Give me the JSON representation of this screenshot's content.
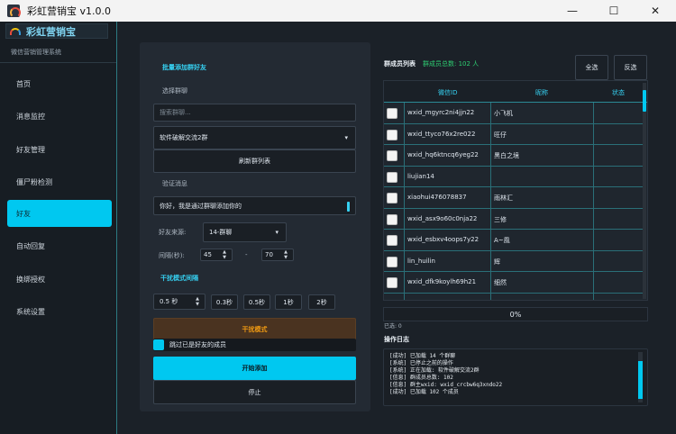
{
  "window": {
    "title": "彩虹营销宝 v1.0.0",
    "icon": "app-rainbow-icon"
  },
  "sidebar": {
    "brand": "彩虹营销宝",
    "subtitle": "微信营销管理系统",
    "items": [
      {
        "label": "首页"
      },
      {
        "label": "消息监控"
      },
      {
        "label": "好友管理"
      },
      {
        "label": "僵尸粉检测"
      },
      {
        "label": "好友",
        "active": true
      },
      {
        "label": "自动回复"
      },
      {
        "label": "换绑授权"
      },
      {
        "label": "系统设置"
      }
    ]
  },
  "left": {
    "section_title": "批量添加群好友",
    "select_group_label": "选择群聊",
    "search_placeholder": "搜索群聊...",
    "selected_group": "软件破解交流2群",
    "refresh_button": "刷新群列表",
    "verify_label": "验证消息",
    "verify_value": "你好，我是通过群聊添加你的",
    "friend_source_label": "好友来源:",
    "friend_source_value": "14-群聊",
    "interval_label": "间隔(秒):",
    "interval_min": "45",
    "interval_sep": "-",
    "interval_max": "70",
    "mode_interval_title": "干扰模式间隔",
    "mode_interval_value": "0.5 秒",
    "presets": [
      "0.3秒",
      "0.5秒",
      "1秒",
      "2秒"
    ],
    "interference_mode_button": "干扰模式",
    "skip_added_label": "跳过已是好友的成员",
    "skip_added_checked": true,
    "start_button": "开始添加",
    "stop_button": "停止"
  },
  "right": {
    "list_title": "群成员列表",
    "total_label": "群成员总数: 102 人",
    "select_all": "全选",
    "invert": "反选",
    "columns": [
      "微信ID",
      "昵称",
      "状态"
    ],
    "rows": [
      {
        "id": "wxid_mgyrc2ni4jjn22",
        "nick": "小飞机",
        "status": ""
      },
      {
        "id": "wxid_ttyco76x2re022",
        "nick": "旺仔",
        "status": ""
      },
      {
        "id": "wxid_hq6ktncq6yeg22",
        "nick": "黑白之境",
        "status": ""
      },
      {
        "id": "liujian14",
        "nick": "",
        "status": ""
      },
      {
        "id": "xiaohui476078837",
        "nick": "雨林汇",
        "status": ""
      },
      {
        "id": "wxid_asx9o60c0nja22",
        "nick": "三修",
        "status": ""
      },
      {
        "id": "wxid_esbxv4oops7y22",
        "nick": "A~風",
        "status": ""
      },
      {
        "id": "lin_huilin",
        "nick": "辉",
        "status": ""
      },
      {
        "id": "wxid_dfk9koylh69h21",
        "nick": "细然",
        "status": ""
      }
    ],
    "progress": "0%",
    "progress_value": 0,
    "selected_text": "已选: 0",
    "log_title": "操作日志",
    "log_lines": [
      "[成功] 已加载 14 个群聊",
      "[系统] 已停止之前的操作",
      "[系统] 正在加载: 软件破解交流2群",
      "[信息] 群成员总数: 102",
      "[信息] 群主wxid: wxid_crcbw6q3xndo22",
      "[成功] 已加载 102 个成员"
    ]
  },
  "colors": {
    "accent": "#00c8f0",
    "success": "#2ecc71",
    "warning": "#f39c12",
    "background": "#1b2128"
  }
}
